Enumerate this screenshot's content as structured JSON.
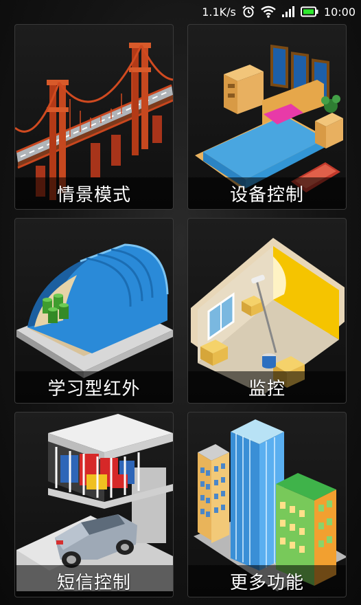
{
  "status_bar": {
    "net_speed": "1.1K/s",
    "time": "10:00",
    "icons": [
      "alarm-icon",
      "wifi-icon",
      "signal-icon",
      "battery-icon"
    ]
  },
  "tiles": [
    {
      "label": "情景模式",
      "icon": "bridge-icon"
    },
    {
      "label": "设备控制",
      "icon": "bedroom-icon"
    },
    {
      "label": "学习型红外",
      "icon": "warehouse-icon"
    },
    {
      "label": "监控",
      "icon": "room-painting-icon"
    },
    {
      "label": "短信控制",
      "icon": "garage-icon"
    },
    {
      "label": "更多功能",
      "icon": "buildings-icon"
    }
  ]
}
